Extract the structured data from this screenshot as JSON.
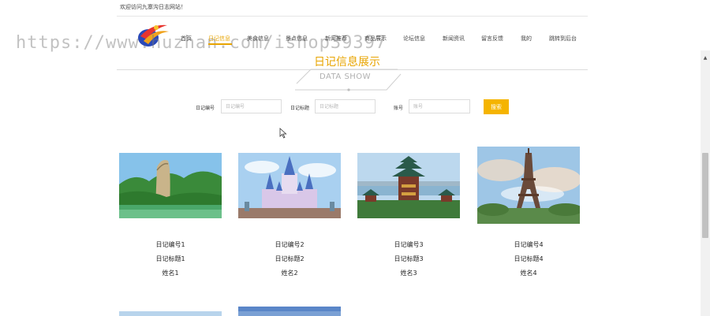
{
  "header": {
    "welcome": "欢迎访问九寨沟日志网站！",
    "watermark": "https://www.huzhan.com/ishop39397"
  },
  "nav": [
    {
      "label": "首页"
    },
    {
      "label": "日记信息"
    },
    {
      "label": "美食信息"
    },
    {
      "label": "景点信息"
    },
    {
      "label": "新闻推荐"
    },
    {
      "label": "商品展示"
    },
    {
      "label": "论坛信息"
    },
    {
      "label": "新闻资讯"
    },
    {
      "label": "留言反馈"
    },
    {
      "label": "我的"
    },
    {
      "label": "跳转到后台"
    }
  ],
  "nav_active": "日记信息",
  "section": {
    "title": "日记信息展示",
    "subtitle": "DATA SHOW"
  },
  "search": {
    "field1_label": "日记编号",
    "field1_placeholder": "日记编号",
    "field2_label": "日记标题",
    "field2_placeholder": "日记标题",
    "field3_label": "账号",
    "field3_placeholder": "账号",
    "button_label": "搜索"
  },
  "cards": [
    {
      "number": "日记编号1",
      "title": "日记标题1",
      "name": "姓名1",
      "scene": "green-mountain-lake"
    },
    {
      "number": "日记编号2",
      "title": "日记标题2",
      "name": "姓名2",
      "scene": "fairytale-castle"
    },
    {
      "number": "日记编号3",
      "title": "日记标题3",
      "name": "姓名3",
      "scene": "chinese-pavilion"
    },
    {
      "number": "日记编号4",
      "title": "日记标题4",
      "name": "姓名4",
      "scene": "eiffel-tower"
    }
  ],
  "colors": {
    "accent": "#e8a400",
    "button": "#f5b400"
  }
}
